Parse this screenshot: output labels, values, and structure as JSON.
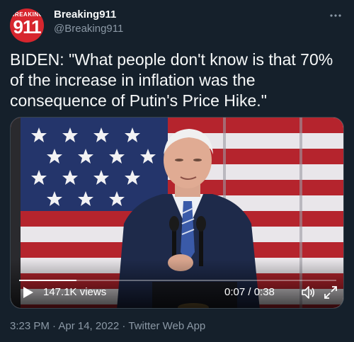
{
  "author": {
    "avatar_small_text": "BREAKING",
    "avatar_big_text": "911",
    "name": "Breaking911",
    "handle": "@Breaking911"
  },
  "more_icon": "more-horizontal-icon",
  "tweet": {
    "text": "BIDEN: \"What people don't know is that 70% of the increase in inflation was the consequence of Putin's Price Hike.\""
  },
  "video": {
    "views": "147.1K views",
    "time": "0:07 / 0:38",
    "progress": 0.18,
    "icons": [
      "play-icon",
      "volume-icon",
      "fullscreen-icon"
    ]
  },
  "meta": {
    "timestamp": "3:23 PM · Apr 14, 2022 · Twitter Web App"
  },
  "colors": {
    "background": "#15202b",
    "text": "#f7f9f9",
    "secondary": "#8b98a5",
    "flag_red": "#b5242d",
    "flag_blue": "#24356b",
    "brand_red": "#d7262e"
  }
}
